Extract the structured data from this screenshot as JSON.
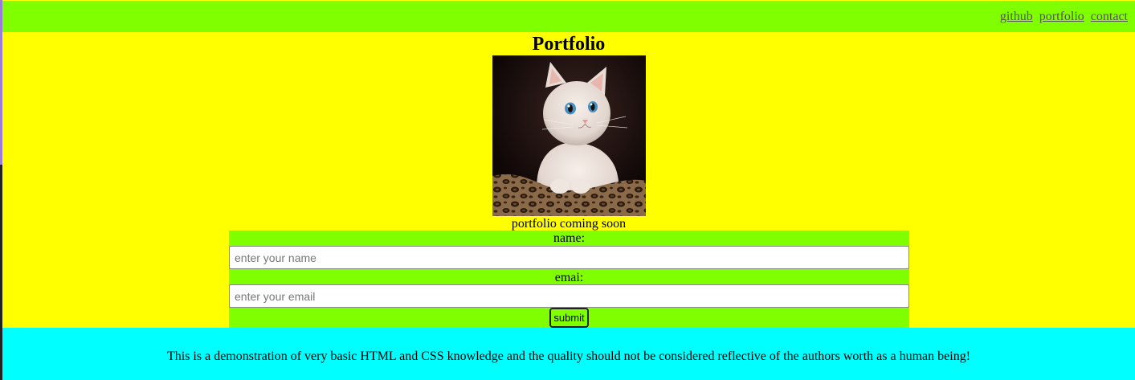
{
  "nav": {
    "links": [
      "github",
      "portfolio",
      "contact"
    ]
  },
  "main": {
    "title": "Portfolio",
    "image": {
      "subject": "white kitten on leopard-print bed"
    },
    "caption": "portfolio coming soon"
  },
  "form": {
    "name_label": "name:",
    "name_placeholder": "enter your name",
    "email_label": "emai:",
    "email_placeholder": "enter your email",
    "submit_label": "submit"
  },
  "footer": {
    "text": "This is a demonstration of very basic HTML and CSS knowledge and the quality should not be considered reflective of the authors worth as a human being!"
  },
  "colors": {
    "nav_bg": "#80ff00",
    "main_bg": "#ffff00",
    "form_bg": "#80ff00",
    "footer_bg": "#00ffff"
  }
}
